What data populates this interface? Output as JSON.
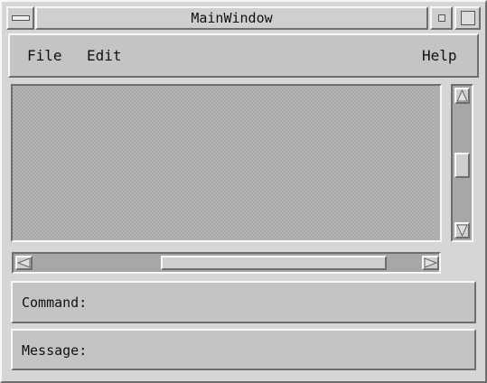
{
  "window": {
    "title": "MainWindow"
  },
  "menubar": {
    "items": [
      {
        "label": "File"
      },
      {
        "label": "Edit"
      },
      {
        "label": "Help"
      }
    ]
  },
  "command_panel": {
    "label": "Command:"
  },
  "message_panel": {
    "label": "Message:"
  },
  "icons": {
    "window_menu": "window-menu-icon",
    "minimize": "minimize-icon",
    "maximize": "maximize-icon",
    "scroll_up": "up-arrow-icon",
    "scroll_down": "down-arrow-icon",
    "scroll_left": "left-arrow-icon",
    "scroll_right": "right-arrow-icon"
  },
  "colors": {
    "window_background": "#d6d6d6",
    "panel": "#c4c4c4",
    "work_area": "#b4b4b4"
  }
}
